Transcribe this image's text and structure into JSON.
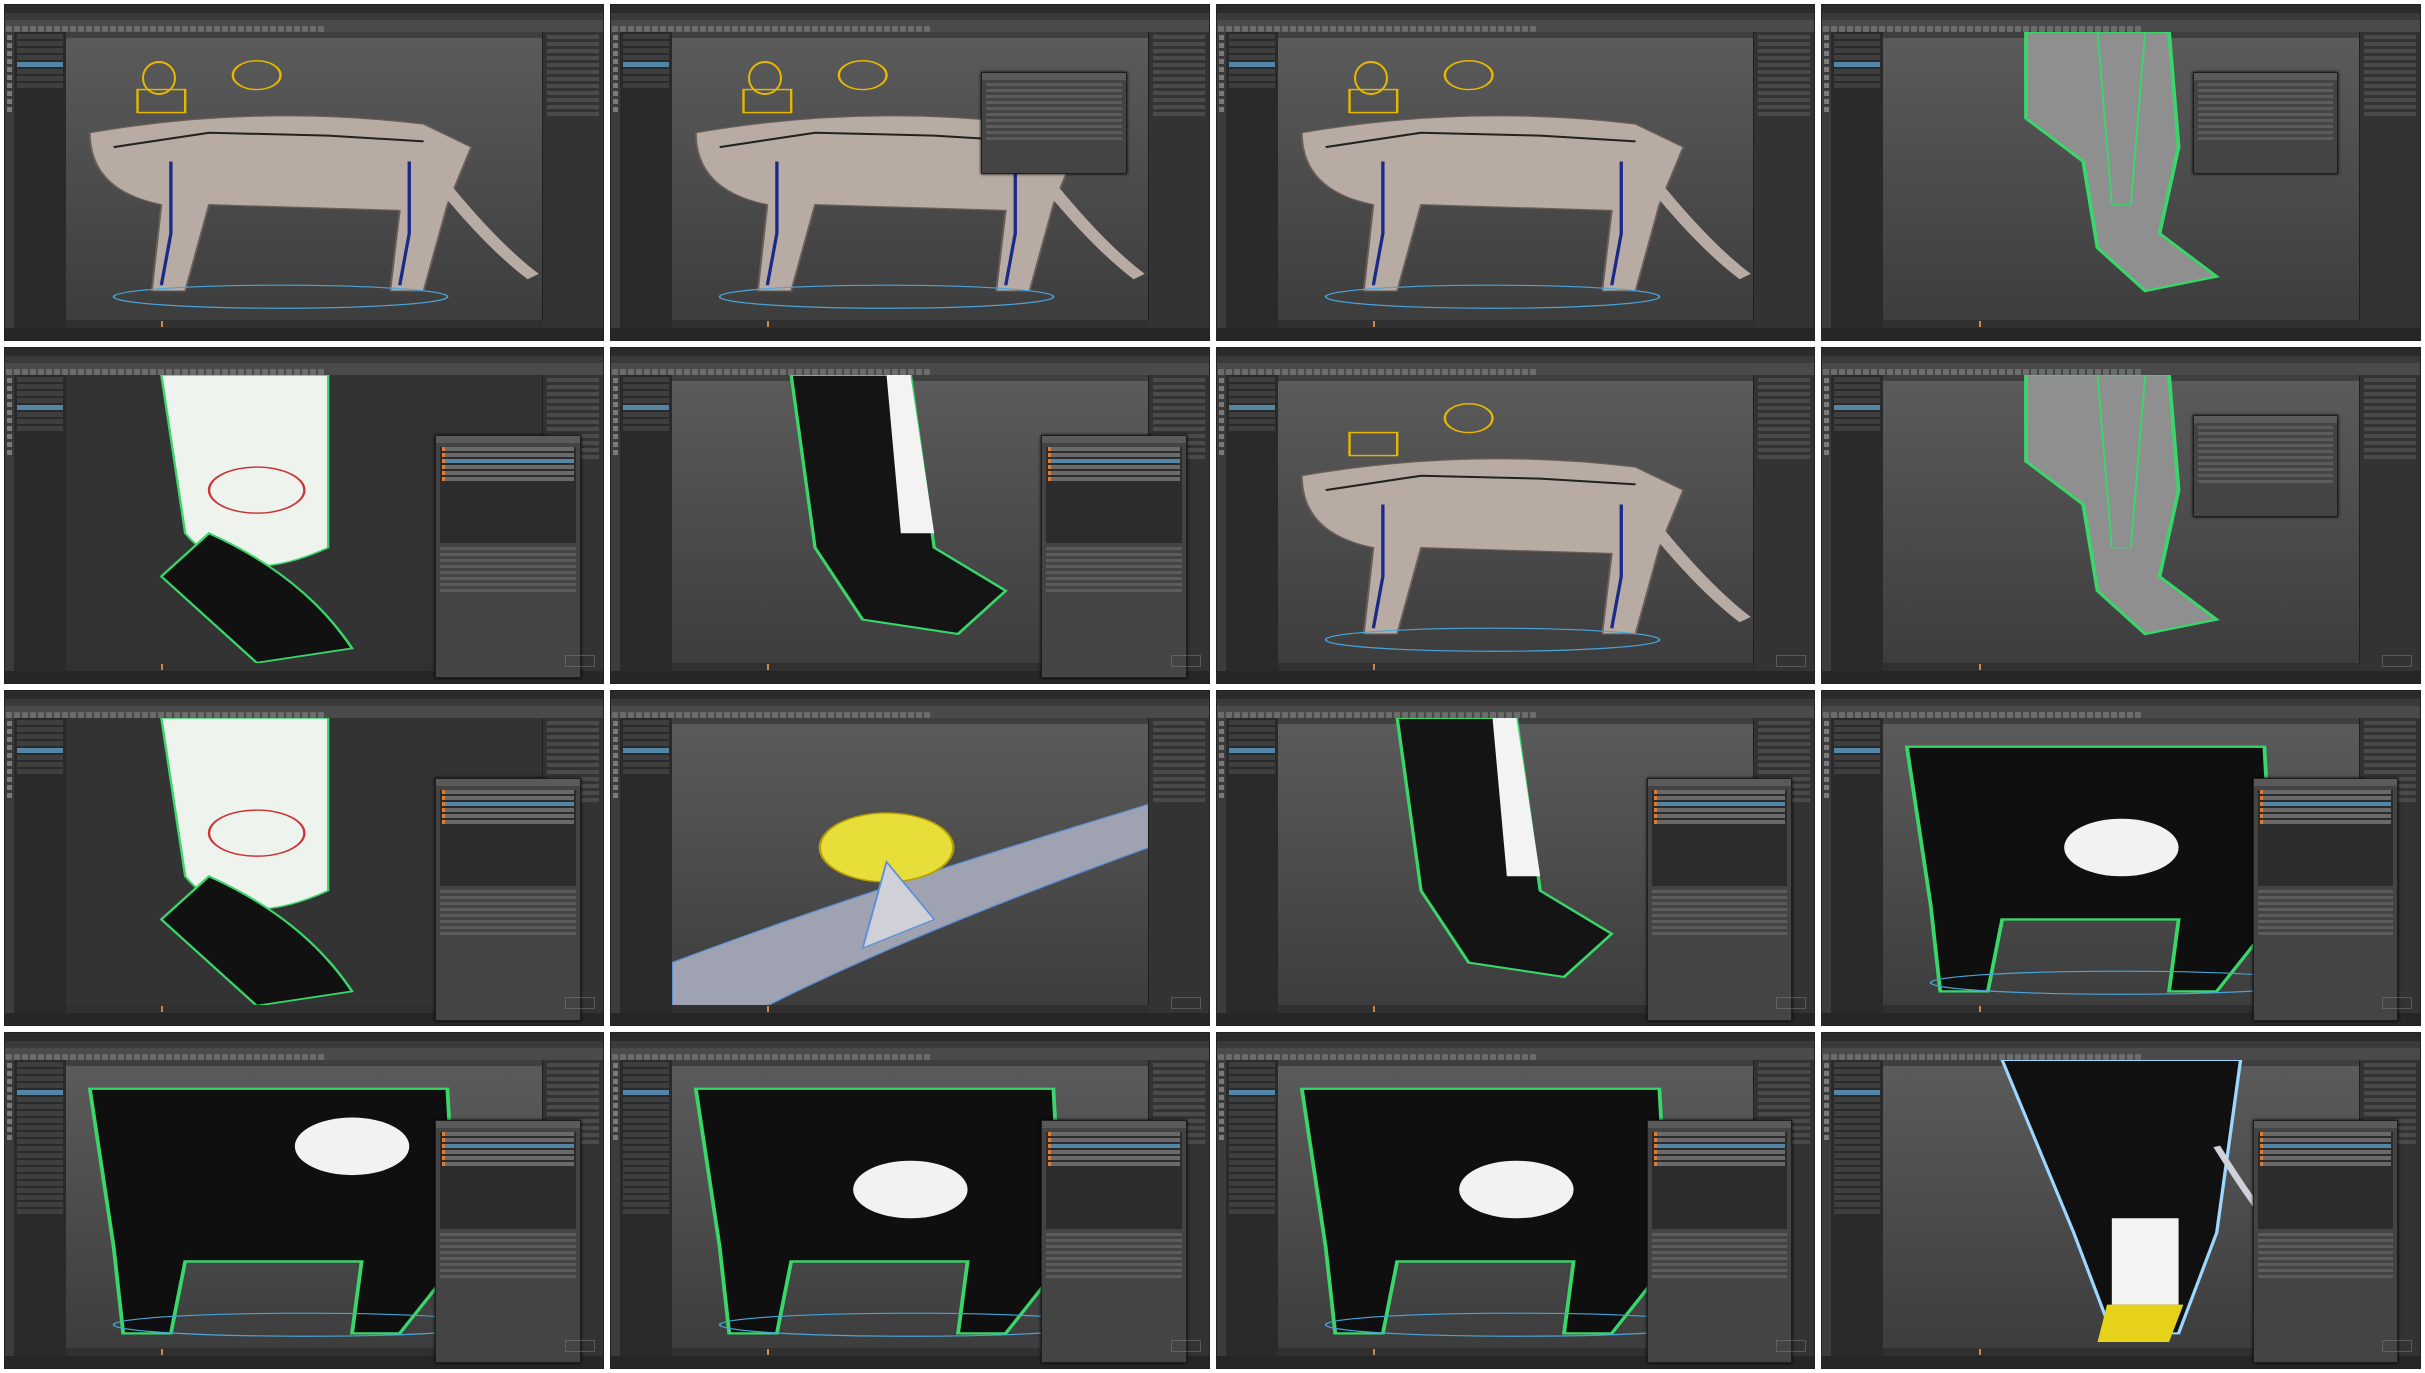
{
  "window_title": "",
  "frames": [
    {
      "id": "1",
      "view": "rig",
      "dialog": "none"
    },
    {
      "id": "2",
      "view": "rig",
      "dialog": "small"
    },
    {
      "id": "3",
      "view": "rig",
      "dialog": "none"
    },
    {
      "id": "4",
      "view": "green-mesh-leg",
      "dialog": "small"
    },
    {
      "id": "5",
      "view": "paint-closeup",
      "dialog": "skin-weights"
    },
    {
      "id": "6",
      "view": "paint-paw",
      "dialog": "skin-weights"
    },
    {
      "id": "7",
      "view": "rig-leg",
      "dialog": "none"
    },
    {
      "id": "8",
      "view": "green-mesh-leg",
      "dialog": "small"
    },
    {
      "id": "9",
      "view": "paint-closeup",
      "dialog": "skin-weights"
    },
    {
      "id": "10",
      "view": "yellow-paw",
      "dialog": "none"
    },
    {
      "id": "11",
      "view": "paint-paw",
      "dialog": "skin-weights"
    },
    {
      "id": "12",
      "view": "paint-body",
      "dialog": "skin-weights"
    },
    {
      "id": "13",
      "view": "paint-hip",
      "dialog": "skin-weights"
    },
    {
      "id": "14",
      "view": "paint-body",
      "dialog": "skin-weights"
    },
    {
      "id": "15",
      "view": "paint-body",
      "dialog": "skin-weights"
    },
    {
      "id": "16",
      "view": "paint-tail",
      "dialog": "skin-weights"
    }
  ],
  "colors": {
    "mesh_green": "#39d66a",
    "mesh_grey": "#b7aba3",
    "selection_blue": "#5285a6",
    "influence_orange": "#e07b32",
    "control_yellow": "#e6b800"
  },
  "icons": [
    "gizmo-icon",
    "watermark-logo"
  ]
}
